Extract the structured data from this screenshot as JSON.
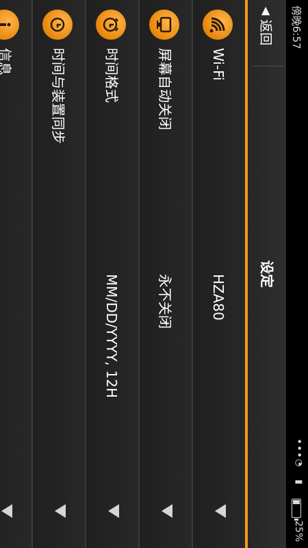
{
  "status_bar": {
    "time": "傍晚6:57",
    "more": "•••",
    "battery_pct": "25%",
    "battery_level": 0.25
  },
  "header": {
    "back_label": "返回",
    "title": "设定"
  },
  "settings": [
    {
      "icon": "wifi-icon",
      "label": "Wi-Fi",
      "value": "HZA80"
    },
    {
      "icon": "screen-icon",
      "label": "屏幕自动关闭",
      "value": "永不关闭"
    },
    {
      "icon": "clock-icon",
      "label": "时间格式",
      "value": "MM/DD/YYYY, 12H"
    },
    {
      "icon": "sync-icon",
      "label": "时间与装置同步",
      "value": ""
    },
    {
      "icon": "info-icon",
      "label": "信息",
      "value": ""
    }
  ]
}
